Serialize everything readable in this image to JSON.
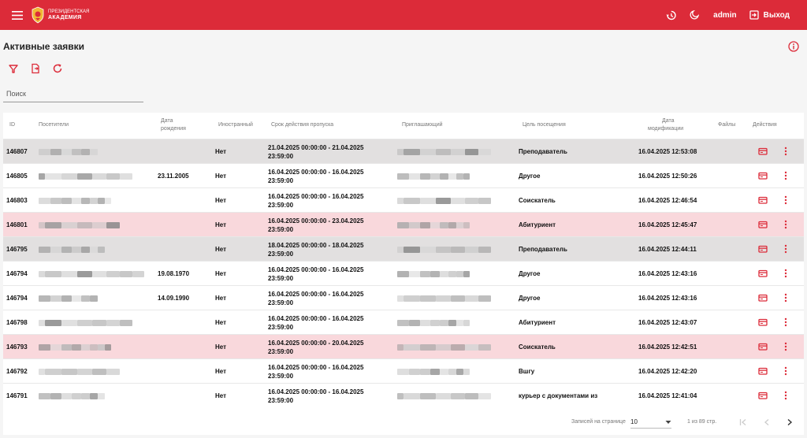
{
  "header": {
    "logo_line1": "ПРЕЗИДЕНТСКАЯ",
    "logo_line2": "АКАДЕМИЯ",
    "user": "admin",
    "logout_label": "Выход",
    "accent": "#dc2b39"
  },
  "page": {
    "title": "Активные заявки",
    "search_placeholder": "Поиск"
  },
  "columns": {
    "id": "ID",
    "visitors": "Посетители",
    "birth_l1": "Дата",
    "birth_l2": "рождения",
    "foreign": "Иностранный",
    "period": "Срок действия пропуска",
    "inviter": "Приглашающий",
    "purpose": "Цель посещения",
    "modified_l1": "Дата",
    "modified_l2": "модификации",
    "files": "Файлы",
    "actions": "Действия"
  },
  "rows": [
    {
      "id": "146807",
      "birth": "",
      "foreign": "Нет",
      "period_l1": "21.04.2025 00:00:00 - 21.04.2025",
      "period_l2": "23:59:00",
      "purpose": "Преподаватель",
      "purpose_l2": "",
      "modified": "16.04.2025 12:53:08",
      "highlight": "grey"
    },
    {
      "id": "146805",
      "birth": "23.11.2005",
      "foreign": "Нет",
      "period_l1": "16.04.2025 00:00:00 - 16.04.2025",
      "period_l2": "23:59:00",
      "purpose": "Другое",
      "purpose_l2": "",
      "modified": "16.04.2025 12:50:26",
      "highlight": ""
    },
    {
      "id": "146803",
      "birth": "",
      "foreign": "Нет",
      "period_l1": "16.04.2025 00:00:00 - 16.04.2025",
      "period_l2": "23:59:00",
      "purpose": "Соискатель",
      "purpose_l2": "",
      "modified": "16.04.2025 12:46:54",
      "highlight": ""
    },
    {
      "id": "146801",
      "birth": "",
      "foreign": "Нет",
      "period_l1": "16.04.2025 00:00:00 - 23.04.2025",
      "period_l2": "23:59:00",
      "purpose": "Абитуриент",
      "purpose_l2": "",
      "modified": "16.04.2025 12:45:47",
      "highlight": "pink"
    },
    {
      "id": "146795",
      "birth": "",
      "foreign": "Нет",
      "period_l1": "18.04.2025 00:00:00 - 18.04.2025",
      "period_l2": "23:59:00",
      "purpose": "Преподаватель",
      "purpose_l2": "",
      "modified": "16.04.2025 12:44:11",
      "highlight": "grey"
    },
    {
      "id": "146794",
      "birth": "19.08.1970",
      "foreign": "Нет",
      "period_l1": "16.04.2025 00:00:00 - 16.04.2025",
      "period_l2": "23:59:00",
      "purpose": "Другое",
      "purpose_l2": "",
      "modified": "16.04.2025 12:43:16",
      "highlight": ""
    },
    {
      "id": "146794",
      "birth": "14.09.1990",
      "foreign": "Нет",
      "period_l1": "16.04.2025 00:00:00 - 16.04.2025",
      "period_l2": "23:59:00",
      "purpose": "Другое",
      "purpose_l2": "",
      "modified": "16.04.2025 12:43:16",
      "highlight": ""
    },
    {
      "id": "146798",
      "birth": "",
      "foreign": "Нет",
      "period_l1": "16.04.2025 00:00:00 - 16.04.2025",
      "period_l2": "23:59:00",
      "purpose": "Абитуриент",
      "purpose_l2": "",
      "modified": "16.04.2025 12:43:07",
      "highlight": ""
    },
    {
      "id": "146793",
      "birth": "",
      "foreign": "Нет",
      "period_l1": "16.04.2025 00:00:00 - 20.04.2025",
      "period_l2": "23:59:00",
      "purpose": "Соискатель",
      "purpose_l2": "",
      "modified": "16.04.2025 12:42:51",
      "highlight": "pink"
    },
    {
      "id": "146792",
      "birth": "",
      "foreign": "Нет",
      "period_l1": "16.04.2025 00:00:00 - 16.04.2025",
      "period_l2": "23:59:00",
      "purpose": "Вшгу",
      "purpose_l2": "",
      "modified": "16.04.2025 12:42:20",
      "highlight": ""
    },
    {
      "id": "146791",
      "birth": "",
      "foreign": "Нет",
      "period_l1": "16.04.2025 00:00:00 - 16.04.2025",
      "period_l2": "23:59:00",
      "purpose": "курьер с документами из",
      "purpose_l2": "",
      "modified": "16.04.2025 12:41:04",
      "highlight": ""
    }
  ],
  "footer": {
    "rows_per_page_label": "Записей на странице",
    "rows_per_page_value": "10",
    "page_info": "1 из 89 стр."
  },
  "icons": {
    "menu": "menu-icon",
    "history": "history-icon",
    "theme": "moon-icon",
    "logout": "logout-icon",
    "info": "info-icon",
    "filter": "filter-icon",
    "export": "export-icon",
    "refresh": "refresh-icon",
    "card": "pass-card-icon",
    "more": "more-vertical-icon"
  }
}
